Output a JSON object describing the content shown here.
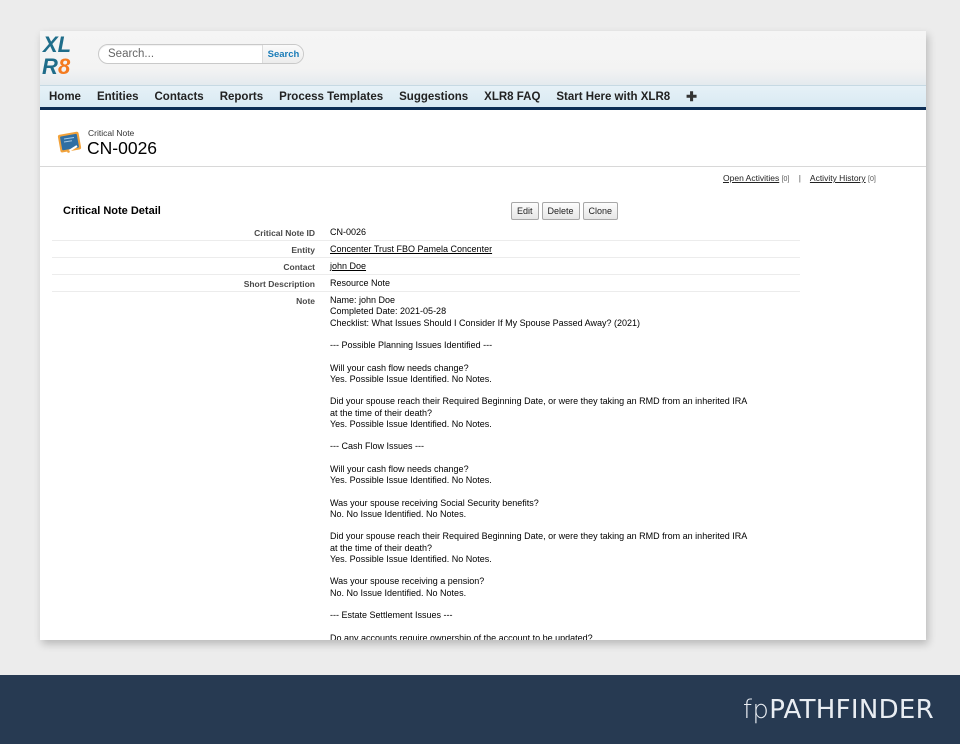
{
  "app": {
    "logo_text_top": "XL",
    "logo_text_bottom_r": "R",
    "logo_text_bottom_8": "8",
    "colors": {
      "logo_teal": "#1f6d8a",
      "logo_orange": "#f47b20",
      "nav_border": "#0d2e55",
      "search_button_text": "#1a7cb8",
      "footer_bg": "#273a52"
    }
  },
  "search": {
    "placeholder": "Search...",
    "value": "",
    "button_label": "Search",
    "icon": "search-field"
  },
  "nav": {
    "items": [
      {
        "label": "Home"
      },
      {
        "label": "Entities"
      },
      {
        "label": "Contacts"
      },
      {
        "label": "Reports"
      },
      {
        "label": "Process Templates"
      },
      {
        "label": "Suggestions"
      },
      {
        "label": "XLR8 FAQ"
      },
      {
        "label": "Start Here with XLR8"
      }
    ],
    "more_icon": "plus-icon",
    "more_label": "✚"
  },
  "record": {
    "icon": "chalkboard-note-icon",
    "type_label": "Critical Note",
    "name": "CN-0026"
  },
  "related": {
    "open_activities_label": "Open Activities",
    "open_activities_count": "[0]",
    "separator": "|",
    "activity_history_label": "Activity History",
    "activity_history_count": "[0]"
  },
  "detail": {
    "section_title": "Critical Note Detail",
    "buttons": {
      "edit": "Edit",
      "delete": "Delete",
      "clone": "Clone"
    },
    "fields": {
      "critical_note_id": {
        "label": "Critical Note ID",
        "value": "CN-0026"
      },
      "entity": {
        "label": "Entity",
        "value": "Concenter Trust FBO Pamela Concenter"
      },
      "contact": {
        "label": "Contact",
        "value": "john Doe"
      },
      "short_description": {
        "label": "Short Description",
        "value": "Resource Note"
      },
      "note": {
        "label": "Note",
        "value": "Name: john Doe\nCompleted Date: 2021-05-28\nChecklist: What Issues Should I Consider If My Spouse Passed Away? (2021)\n\n--- Possible Planning Issues Identified ---\n\nWill your cash flow needs change?\nYes. Possible Issue Identified. No Notes.\n\nDid your spouse reach their Required Beginning Date, or were they taking an RMD from an inherited IRA\nat the time of their death?\nYes. Possible Issue Identified. No Notes.\n\n--- Cash Flow Issues ---\n\nWill your cash flow needs change?\nYes. Possible Issue Identified. No Notes.\n\nWas your spouse receiving Social Security benefits?\nNo. No Issue Identified. No Notes.\n\nDid your spouse reach their Required Beginning Date, or were they taking an RMD from an inherited IRA\nat the time of their death?\nYes. Possible Issue Identified. No Notes.\n\nWas your spouse receiving a pension?\nNo. No Issue Identified. No Notes.\n\n--- Estate Settlement Issues ---\n\nDo any accounts require ownership of the account to be updated?"
      }
    }
  },
  "footer": {
    "brand_prefix": "fp",
    "brand_name": "PATHFINDER"
  }
}
